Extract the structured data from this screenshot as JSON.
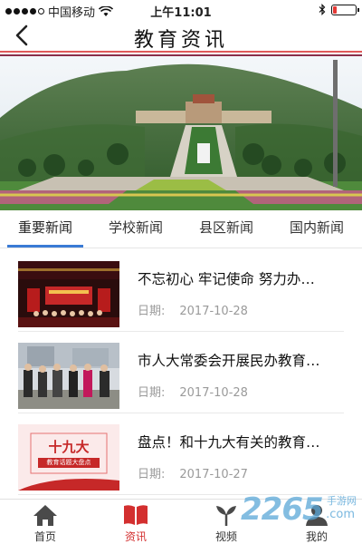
{
  "status_bar": {
    "carrier": "中国移动",
    "time": "上午11:01",
    "battery_level": 0.15
  },
  "nav": {
    "title": "教育资讯",
    "back_icon": "chevron-left-icon"
  },
  "tabs": [
    {
      "label": "重要新闻",
      "active": true
    },
    {
      "label": "学校新闻",
      "active": false
    },
    {
      "label": "县区新闻",
      "active": false
    },
    {
      "label": "国内新闻",
      "active": false
    }
  ],
  "news": [
    {
      "title": "不忘初心 牢记使命 努力办…",
      "date_label": "日期:",
      "date": "2017-10-28"
    },
    {
      "title": "市人大常委会开展民办教育…",
      "date_label": "日期:",
      "date": "2017-10-28"
    },
    {
      "title": "盘点！和十九大有关的教育…",
      "date_label": "日期:",
      "date": "2017-10-27"
    }
  ],
  "thumb_texts": {
    "third_main": "十九大",
    "third_sub": "教育话题大盘点"
  },
  "bottom_nav": [
    {
      "label": "首页",
      "icon": "home-icon",
      "active": false
    },
    {
      "label": "资讯",
      "icon": "book-icon",
      "active": true
    },
    {
      "label": "视频",
      "icon": "video-icon",
      "active": false
    },
    {
      "label": "我的",
      "icon": "user-icon",
      "active": false
    }
  ],
  "watermark": {
    "brand": "2265",
    "sub": "手游网",
    "url": ".com"
  },
  "colors": {
    "accent_red": "#d32f2f",
    "tab_underline": "#3a7bd5"
  }
}
